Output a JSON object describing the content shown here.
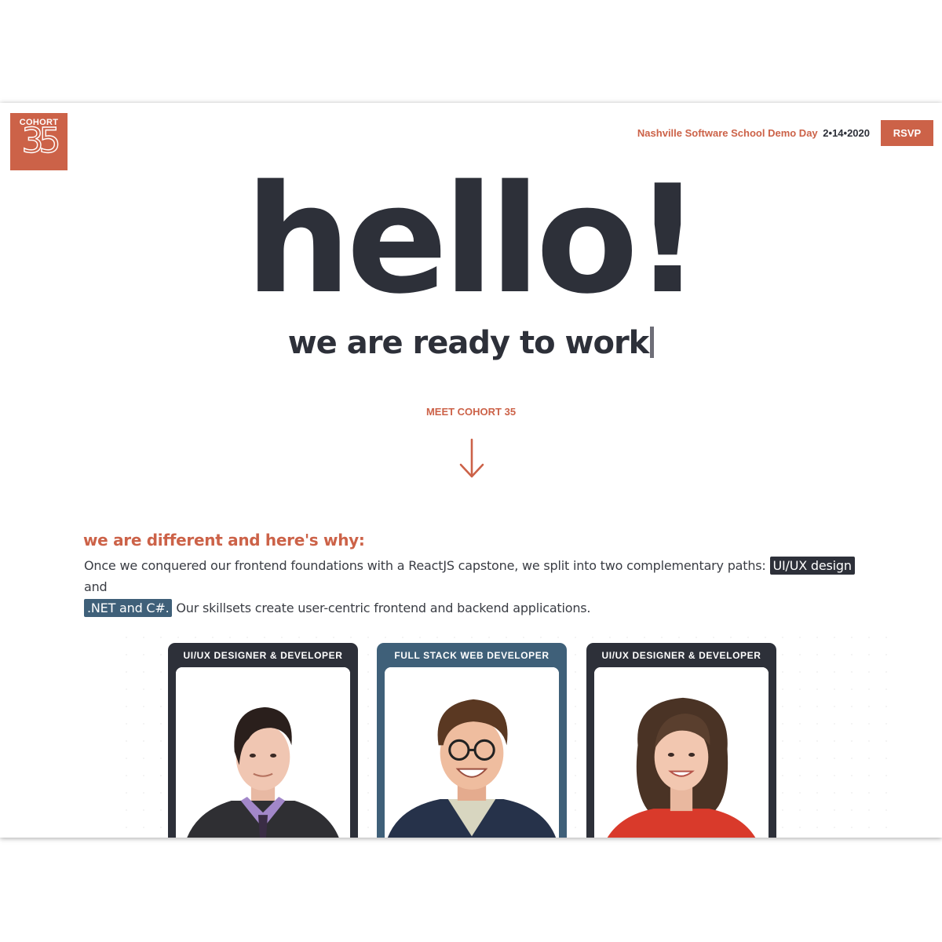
{
  "header": {
    "logo": {
      "top_text": "COHORT",
      "number": "35"
    },
    "event_name": "Nashville Software School Demo Day",
    "event_date": "2•14•2020",
    "rsvp_label": "RSVP"
  },
  "hero": {
    "title": "hello!",
    "tagline": "we are ready to work"
  },
  "meet": {
    "label": "MEET COHORT 35",
    "arrow_icon": "arrow-down-icon"
  },
  "why": {
    "heading": "we are different and here's why:",
    "text_1": "Once we conquered our  frontend foundations  with a ReactJS capstone, we split into two complementary paths: ",
    "highlight_1": "UI/UX design",
    "text_2": " and ",
    "highlight_2": ".NET and C#.",
    "text_3": " Our skillsets create user-centric frontend and backend applications."
  },
  "cards": [
    {
      "role": "UI/UX DESIGNER & DEVELOPER",
      "color": "#2d3039"
    },
    {
      "role": "FULL STACK WEB DEVELOPER",
      "color": "#3f6079"
    },
    {
      "role": "UI/UX DESIGNER & DEVELOPER",
      "color": "#2d3039"
    }
  ],
  "colors": {
    "accent": "#cc6248",
    "dark": "#2d3039",
    "blue": "#3f6079"
  }
}
